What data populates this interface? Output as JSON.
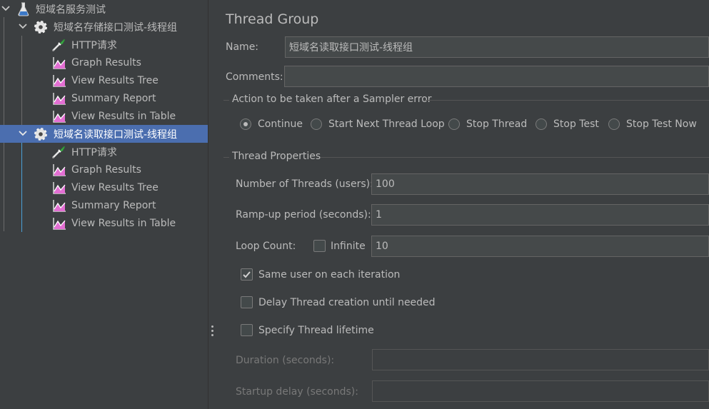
{
  "tree": {
    "items": [
      {
        "label": "短域名服务测试",
        "icon": "test-plan-flask-icon"
      },
      {
        "label": "短域名存储接口测试-线程组",
        "icon": "thread-group-gear-icon"
      },
      {
        "label": "HTTP请求",
        "icon": "http-sampler-pipette-icon"
      },
      {
        "label": "Graph Results",
        "icon": "listener-chart-icon"
      },
      {
        "label": "View Results Tree",
        "icon": "listener-chart-icon"
      },
      {
        "label": "Summary Report",
        "icon": "listener-chart-icon"
      },
      {
        "label": "View Results in Table",
        "icon": "listener-chart-icon"
      },
      {
        "label": "短域名读取接口测试-线程组",
        "icon": "thread-group-gear-icon",
        "selected": true
      },
      {
        "label": "HTTP请求",
        "icon": "http-sampler-pipette-icon"
      },
      {
        "label": "Graph Results",
        "icon": "listener-chart-icon"
      },
      {
        "label": "View Results Tree",
        "icon": "listener-chart-icon"
      },
      {
        "label": "Summary Report",
        "icon": "listener-chart-icon"
      },
      {
        "label": "View Results in Table",
        "icon": "listener-chart-icon"
      }
    ]
  },
  "panel": {
    "title": "Thread Group",
    "name_label": "Name:",
    "name_value": "短域名读取接口测试-线程组",
    "comments_label": "Comments:",
    "comments_value": "",
    "action_section": "Action to be taken after a Sampler error",
    "actions": [
      {
        "label": "Continue",
        "selected": true
      },
      {
        "label": "Start Next Thread Loop",
        "selected": false
      },
      {
        "label": "Stop Thread",
        "selected": false
      },
      {
        "label": "Stop Test",
        "selected": false
      },
      {
        "label": "Stop Test Now",
        "selected": false
      }
    ],
    "thread_section": "Thread Properties",
    "threads_label": "Number of Threads (users):",
    "threads_value": "100",
    "rampup_label": "Ramp-up period (seconds):",
    "rampup_value": "1",
    "loop_label": "Loop Count:",
    "infinite_label": "Infinite",
    "infinite_checked": false,
    "loop_value": "10",
    "same_user_label": "Same user on each iteration",
    "same_user_checked": true,
    "delay_label": "Delay Thread creation until needed",
    "delay_checked": false,
    "lifetime_label": "Specify Thread lifetime",
    "lifetime_checked": false,
    "duration_label": "Duration (seconds):",
    "duration_value": "",
    "startup_label": "Startup delay (seconds):",
    "startup_value": ""
  },
  "colors": {
    "background": "#3c3f41",
    "selection": "#4b6eaf",
    "field": "#45494a",
    "text": "#bbbbbb"
  }
}
